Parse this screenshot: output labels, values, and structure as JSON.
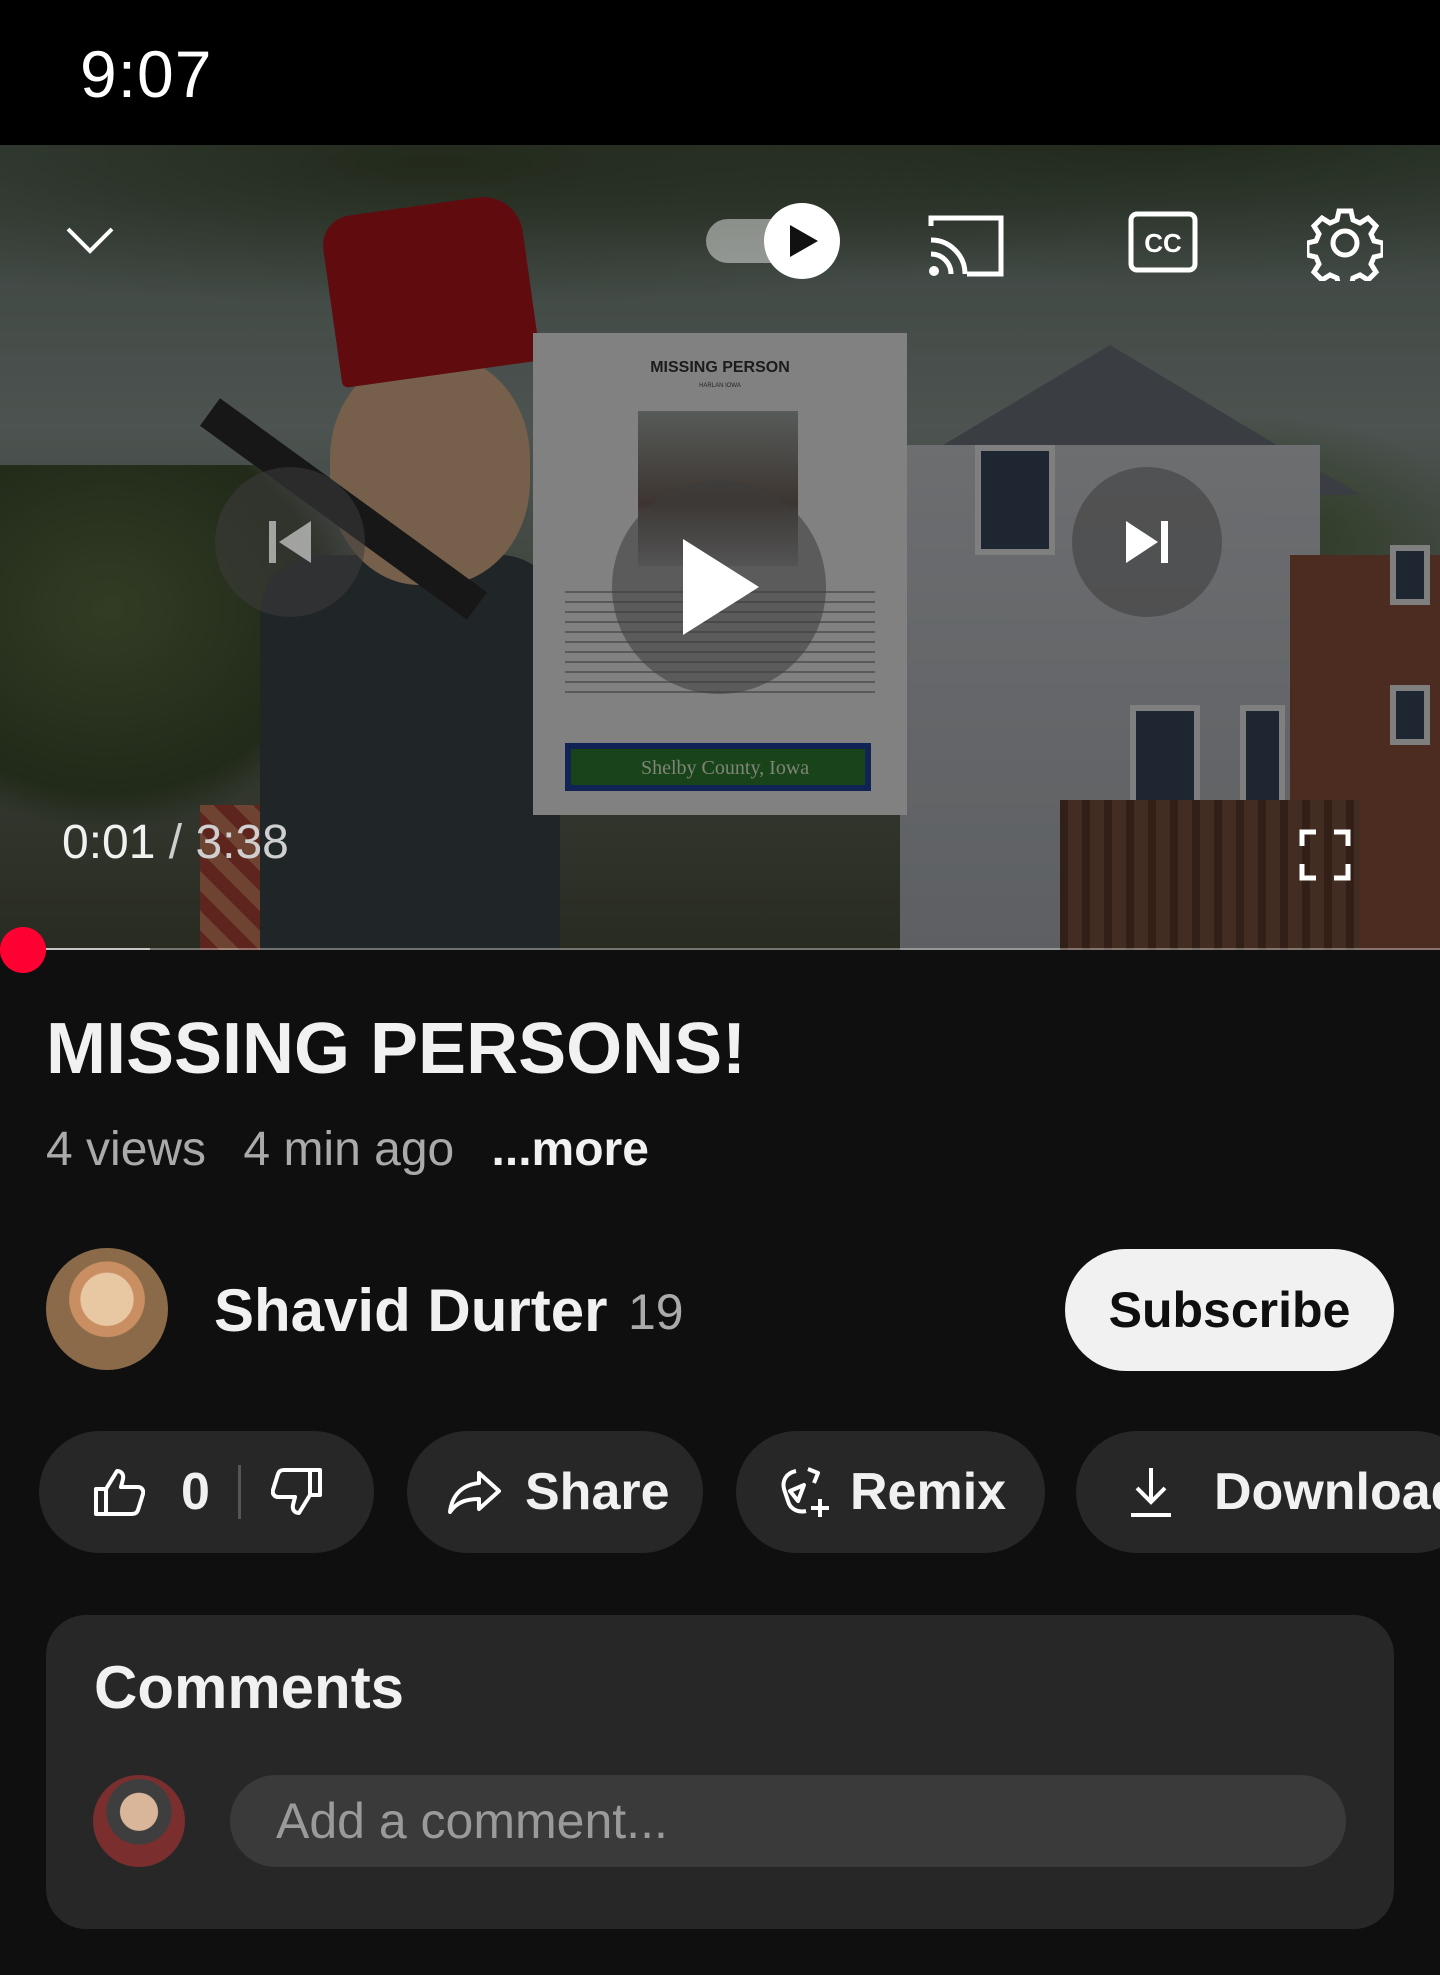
{
  "status_bar": {
    "time": "9:07"
  },
  "player": {
    "current_time": "0:01",
    "separator": " / ",
    "duration": "3:38",
    "autoplay_on": true,
    "flyer": {
      "title": "MISSING PERSON",
      "subtitle": "HARLAN IOWA",
      "banner": "Shelby County, Iowa"
    }
  },
  "video": {
    "title": "MISSING PERSONS!",
    "views": "4 views",
    "age": "4 min ago",
    "more": "...more"
  },
  "channel": {
    "name": "Shavid Durter",
    "subscribers": "19",
    "subscribe_label": "Subscribe"
  },
  "actions": {
    "like_count": "0",
    "share": "Share",
    "remix": "Remix",
    "download": "Download"
  },
  "comments": {
    "title": "Comments",
    "placeholder": "Add a comment..."
  },
  "colors": {
    "accent": "#ff0033",
    "background": "#0f0f0f",
    "surface": "#272727"
  },
  "icons": [
    "chevron-down-icon",
    "autoplay-toggle-icon",
    "cast-icon",
    "captions-icon",
    "settings-gear-icon",
    "previous-icon",
    "play-icon",
    "next-icon",
    "fullscreen-icon",
    "thumbs-up-icon",
    "thumbs-down-icon",
    "share-arrow-icon",
    "remix-icon",
    "download-icon"
  ]
}
